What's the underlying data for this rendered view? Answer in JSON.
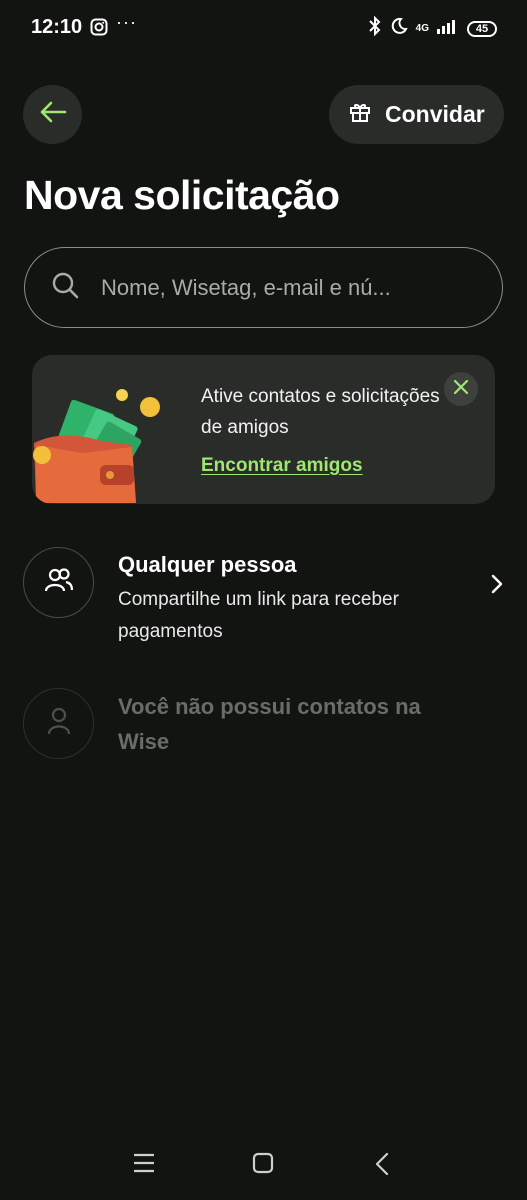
{
  "status_bar": {
    "time": "12:10",
    "more": "···",
    "network": "4G",
    "battery": "45",
    "icons": [
      "instagram-icon",
      "bluetooth-icon",
      "moon-icon",
      "signal-icon",
      "battery-icon"
    ]
  },
  "header": {
    "back_icon": "arrow-left-icon",
    "invite_label": "Convidar",
    "invite_icon": "gift-icon"
  },
  "page": {
    "title": "Nova solicitação"
  },
  "search": {
    "placeholder": "Nome, Wisetag, e-mail e nú...",
    "value": ""
  },
  "promo": {
    "text": "Ative contatos e solicitações de amigos",
    "link": "Encontrar amigos",
    "close_icon": "close-icon",
    "illustration": "wallet-with-money-illustration"
  },
  "list": {
    "anyone": {
      "title": "Qualquer pessoa",
      "subtitle": "Compartilhe um link para receber pagamentos",
      "icon": "people-icon"
    },
    "no_contacts": {
      "title": "Você não possui contatos na Wise",
      "icon": "person-icon"
    }
  },
  "colors": {
    "background": "#121412",
    "surface": "#2a2c2a",
    "accent": "#9fe870",
    "muted": "#6a6c6a"
  },
  "nav_bar": {
    "icons": [
      "menu-icon",
      "home-square-icon",
      "back-chevron-icon"
    ]
  }
}
